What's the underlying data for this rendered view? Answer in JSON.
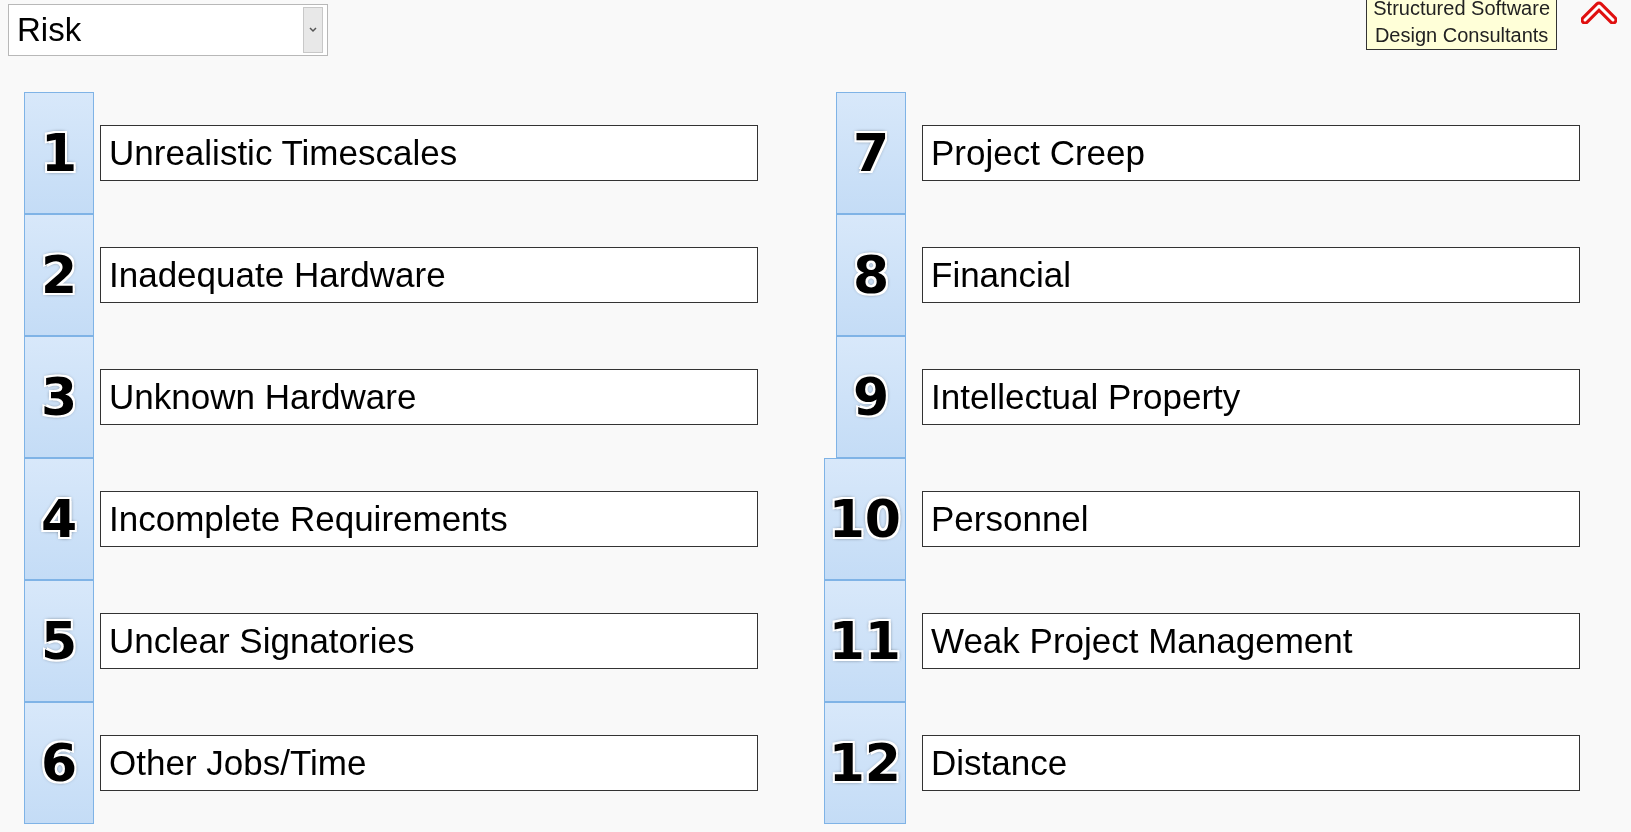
{
  "category_select": {
    "value": "Risk"
  },
  "logo": {
    "lines": [
      "Structured Software",
      "Design Consultants"
    ]
  },
  "columns": [
    [
      {
        "number": "1",
        "label": "Unrealistic Timescales"
      },
      {
        "number": "2",
        "label": "Inadequate Hardware"
      },
      {
        "number": "3",
        "label": "Unknown Hardware"
      },
      {
        "number": "4",
        "label": "Incomplete Requirements"
      },
      {
        "number": "5",
        "label": "Unclear Signatories"
      },
      {
        "number": "6",
        "label": "Other Jobs/Time"
      }
    ],
    [
      {
        "number": "7",
        "label": "Project Creep"
      },
      {
        "number": "8",
        "label": "Financial"
      },
      {
        "number": "9",
        "label": "Intellectual Property"
      },
      {
        "number": "10",
        "label": "Personnel"
      },
      {
        "number": "11",
        "label": "Weak Project Management"
      },
      {
        "number": "12",
        "label": "Distance"
      }
    ]
  ]
}
